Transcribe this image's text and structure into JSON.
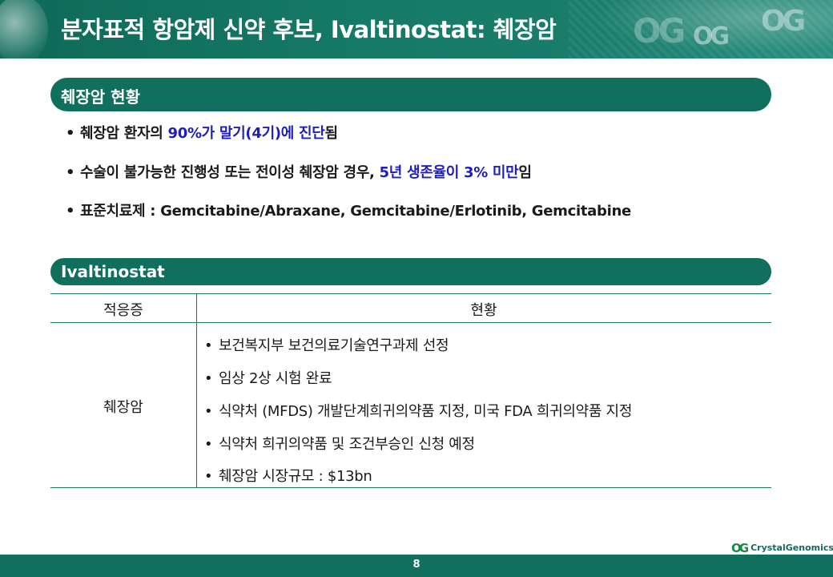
{
  "header": {
    "title": "분자표적 항암제 신약 후보, Ivaltinostat: 췌장암",
    "ghost_logo": "OG"
  },
  "section1": {
    "title": "췌장암 현황",
    "bullets": [
      {
        "pre": "췌장암 환자의 ",
        "hl": "90%가 말기(4기)에 진단",
        "post": "됨"
      },
      {
        "pre": "수술이 불가능한 진행성 또는 전이성 췌장암 경우, ",
        "hl": "5년 생존율이 3% 미만",
        "post": "임"
      },
      {
        "pre": "표준치료제 : Gemcitabine/Abraxane, Gemcitabine/Erlotinib, Gemcitabine",
        "hl": "",
        "post": ""
      }
    ]
  },
  "section2": {
    "title": "Ivaltinostat",
    "table": {
      "col_indication": "적응증",
      "col_status": "현황",
      "indication": "췌장암",
      "status_items": [
        "보건복지부 보건의료기술연구과제 선정",
        "임상 2상 시험 완료",
        "식약처 (MFDS) 개발단계희귀의약품 지정, 미국 FDA 희귀의약품 지정",
        "식약처 희귀의약품 및 조건부승인 신청 예정",
        "췌장암 시장규모 : $13bn"
      ]
    }
  },
  "footer": {
    "logo_mark": "OG",
    "logo_name": "CrystalGenomics",
    "page_number": "8"
  },
  "bullet_char": "•",
  "colors": {
    "accent": "#11705d",
    "highlight": "#1d1dc0"
  }
}
